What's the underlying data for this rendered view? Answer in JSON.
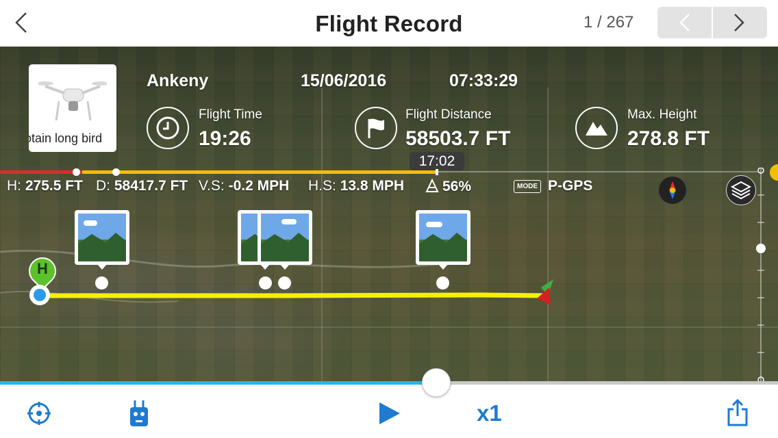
{
  "header": {
    "title": "Flight Record",
    "counter": "1 / 267"
  },
  "aircraft": {
    "name_caption": "otain long bird"
  },
  "flight": {
    "location": "Ankeny",
    "date": "15/06/2016",
    "time": "07:33:29",
    "stats": [
      {
        "label": "Flight Time",
        "value": "19:26",
        "icon": "clock-icon"
      },
      {
        "label": "Flight Distance",
        "value": "58503.7 FT",
        "icon": "flag-icon"
      },
      {
        "label": "Max. Height",
        "value": "278.8 FT",
        "icon": "mountain-icon"
      }
    ]
  },
  "timeline": {
    "current_time": "17:02",
    "progress_fraction": 0.56
  },
  "telemetry": {
    "h_label": "H:",
    "h_value": "275.5 FT",
    "d_label": "D:",
    "d_value": "58417.7 FT",
    "vs_label": "V.S:",
    "vs_value": "-0.2 MPH",
    "hs_label": "H.S:",
    "hs_value": "13.8 MPH",
    "battery_value": "56%",
    "mode_badge": "MODE",
    "mode_value": "P-GPS"
  },
  "map": {
    "home_marker": "H",
    "path_color": "#f5f000",
    "photo_markers": 4
  },
  "playback": {
    "speed": "x1",
    "accent": "#1f7ad0",
    "progress_color": "#29b5e8"
  },
  "icons": [
    "back-chevron-icon",
    "prev-chevron-icon",
    "next-chevron-icon",
    "clock-icon",
    "flag-icon",
    "mountain-icon",
    "battery-icon",
    "compass-icon",
    "layers-icon",
    "locate-icon",
    "remote-controller-icon",
    "play-icon",
    "share-icon"
  ]
}
